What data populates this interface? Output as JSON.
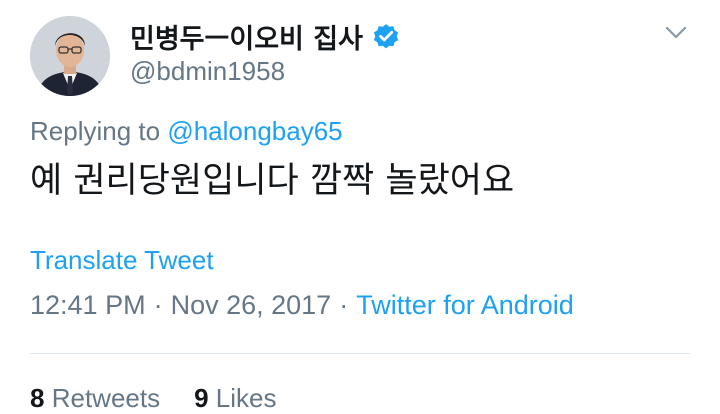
{
  "author": {
    "display_name": "민병두ㅡ이오비 집사",
    "handle": "@bdmin1958",
    "verified": true
  },
  "reply": {
    "prefix": "Replying to ",
    "to_handle": "@halongbay65"
  },
  "tweet": {
    "text": "예 권리당원입니다 깜짝 놀랐어요",
    "translate_label": "Translate Tweet",
    "time": "12:41 PM",
    "separator": "·",
    "date": "Nov 26, 2017",
    "client": "Twitter for Android"
  },
  "stats": {
    "retweets_count": "8",
    "retweets_label": "Retweets",
    "likes_count": "9",
    "likes_label": "Likes"
  },
  "colors": {
    "link": "#1da1f2",
    "secondary_text": "#657786",
    "primary_text": "#14171a",
    "divider": "#e1e8ed"
  },
  "icons": {
    "verified": "verified-badge-icon",
    "menu": "chevron-down-icon"
  }
}
